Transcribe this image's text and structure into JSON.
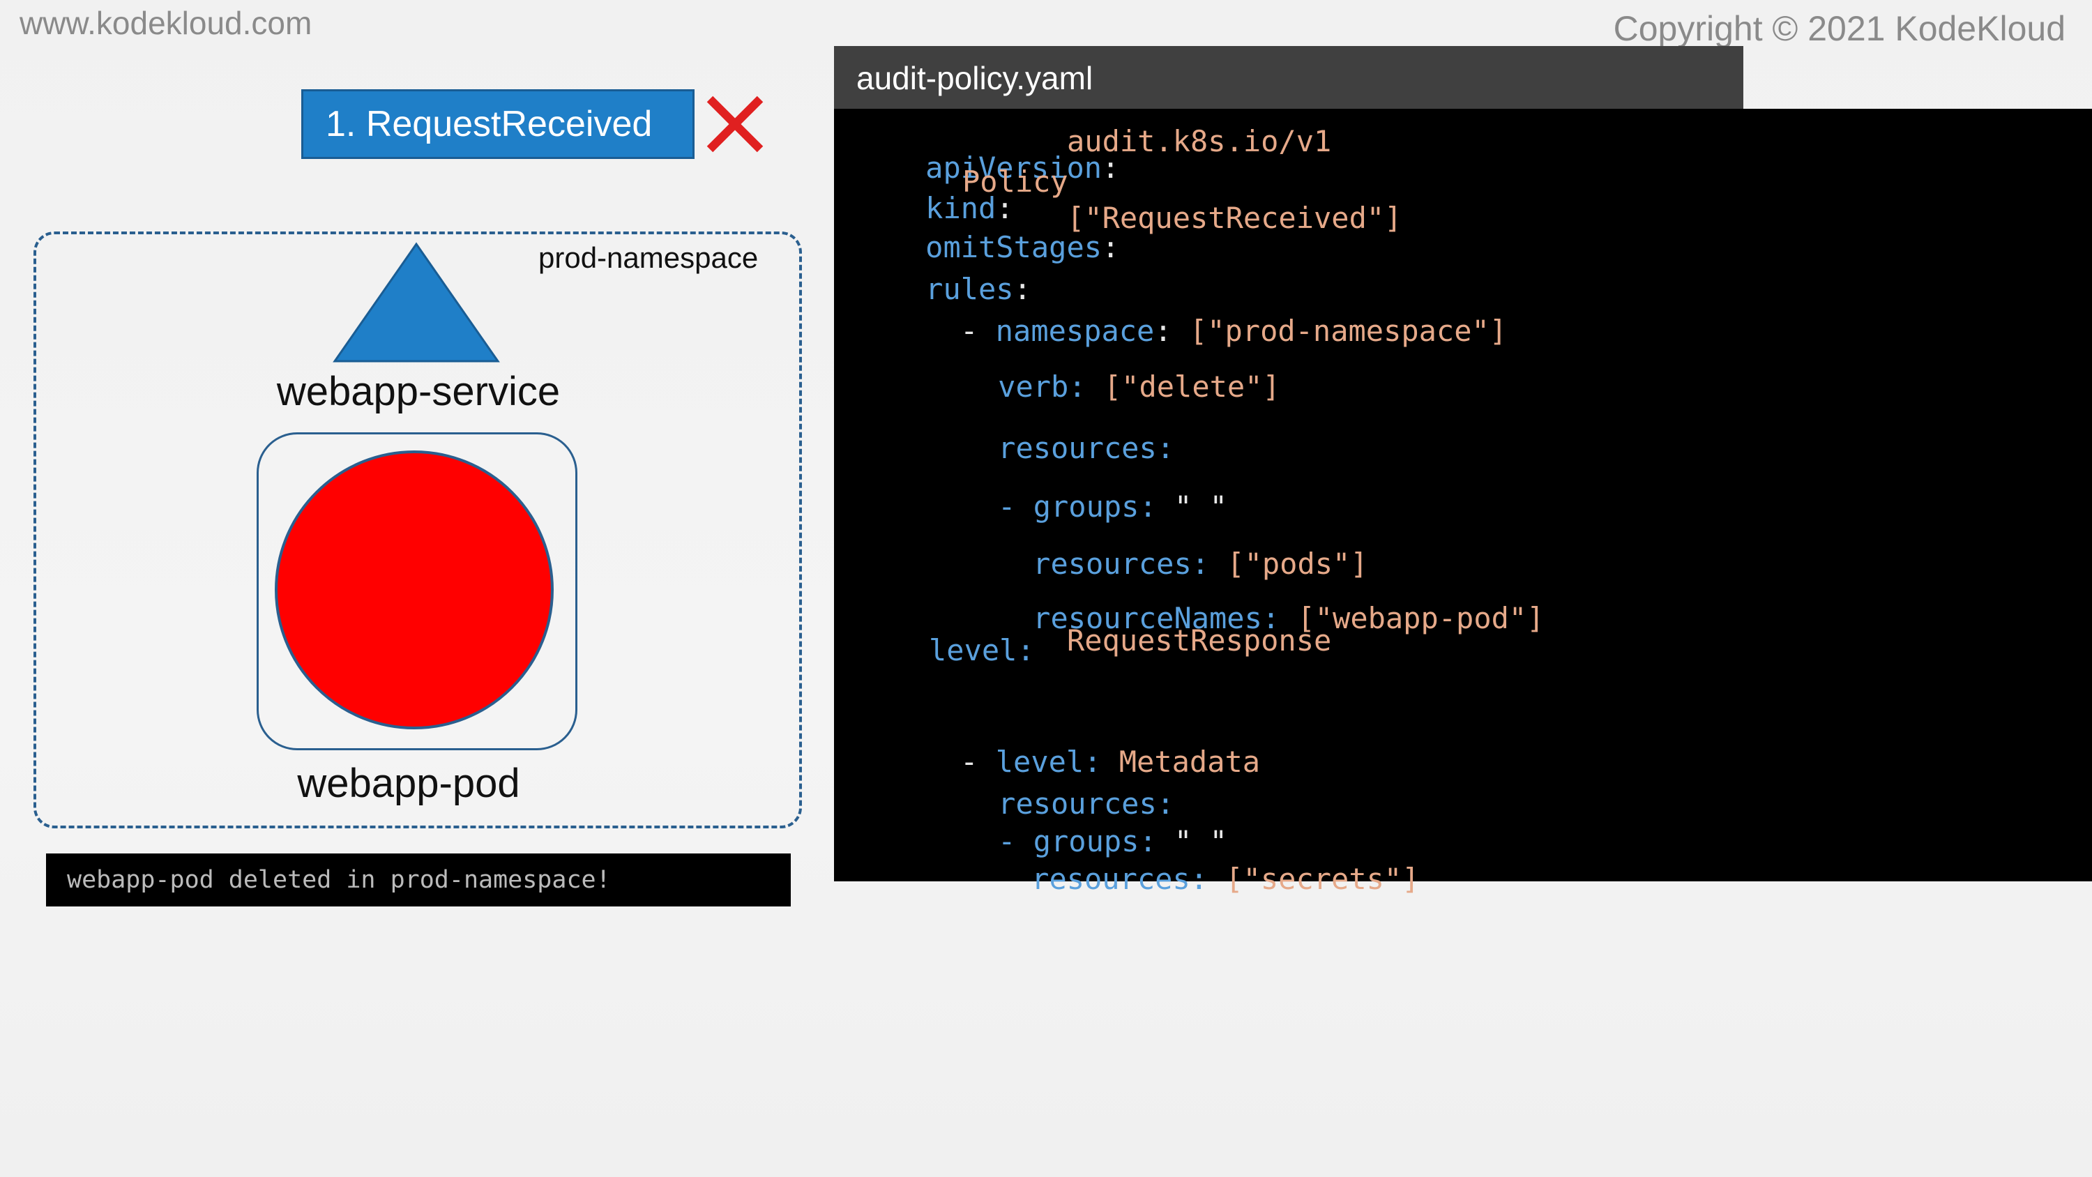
{
  "header": {
    "site": "www.kodekloud.com",
    "copyright": "Copyright © 2021 KodeKloud"
  },
  "stage": {
    "label": "1. RequestReceived",
    "status_icon": "cross-mark"
  },
  "namespace": {
    "label": "prod-namespace",
    "service_label": "webapp-service",
    "pod_label": "webapp-pod"
  },
  "terminal": {
    "message": "webapp-pod deleted in prod-namespace!"
  },
  "file": {
    "name": "audit-policy.yaml"
  },
  "code": {
    "l1_key": "apiVersion",
    "l1_colon": ":",
    "l1_val": "audit.k8s.io/v1",
    "l2_key": "kind",
    "l2_colon": ":",
    "l2_val": "Policy",
    "l3_key": "omitStages",
    "l3_colon": ":",
    "l3_val": "[\"RequestReceived\"]",
    "l4_key": "rules",
    "l4_colon": ":",
    "l5_dash": "-",
    "l5_key": "namespace",
    "l5_colon": ":",
    "l5_val": "[\"prod-namespace\"]",
    "l6_key": "verb:",
    "l6_val": "[\"delete\"]",
    "l7_key": "resources:",
    "l8_key": "- groups:",
    "l8_val": "\" \"",
    "l9_key": "resources:",
    "l9_val": "[\"pods\"]",
    "l10_key": "resourceNames:",
    "l10_val": "[\"webapp-pod\"]",
    "l11_key": "level:",
    "l11_val": "RequestResponse",
    "l12_dash": "-",
    "l12_key": "level:",
    "l12_val": "Metadata",
    "l13_key": "resources:",
    "l14_key": "- groups:",
    "l14_val": "\" \"",
    "l15_key": "resources:",
    "l15_val": "[\"secrets\"]"
  },
  "colors": {
    "stage_blue": "#1f7fc8",
    "cross_red": "#e02020",
    "pod_red": "#ff0000",
    "service_blue": "#1f7fc8",
    "yaml_key": "#5aa0dd",
    "yaml_value": "#e6a989"
  }
}
